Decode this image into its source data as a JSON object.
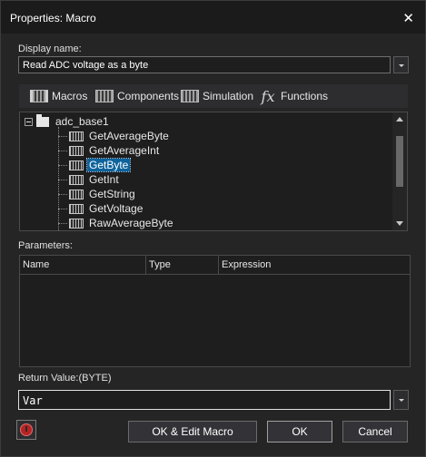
{
  "window": {
    "title": "Properties: Macro"
  },
  "display_name": {
    "label": "Display name:",
    "value": "Read ADC voltage as a byte"
  },
  "tabs": [
    {
      "label": "Macros",
      "icon": "macros-icon"
    },
    {
      "label": "Components",
      "icon": "components-icon"
    },
    {
      "label": "Simulation",
      "icon": "simulation-icon"
    },
    {
      "label": "Functions",
      "icon": "functions-fx-icon"
    }
  ],
  "tree": {
    "root": "adc_base1",
    "items": [
      "GetAverageByte",
      "GetAverageInt",
      "GetByte",
      "GetInt",
      "GetString",
      "GetVoltage",
      "RawAverageByte"
    ],
    "selected": "GetByte"
  },
  "parameters": {
    "label": "Parameters:",
    "columns": [
      "Name",
      "Type",
      "Expression"
    ]
  },
  "return_value": {
    "label": "Return Value:(BYTE)",
    "value": "Var"
  },
  "buttons": {
    "ok_edit": "OK & Edit Macro",
    "ok": "OK",
    "cancel": "Cancel"
  },
  "colors": {
    "background": "#252526",
    "selection": "#0e639c",
    "help_icon": "#b52323"
  }
}
